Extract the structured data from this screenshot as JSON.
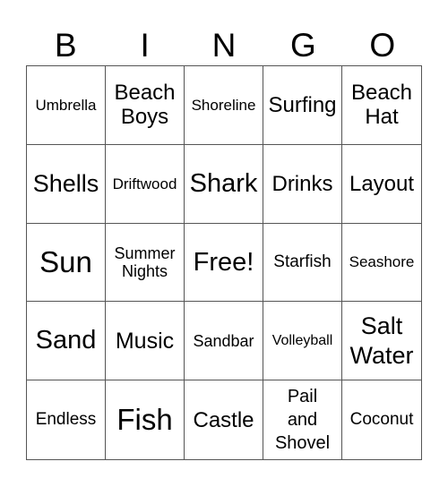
{
  "header": [
    "B",
    "I",
    "N",
    "G",
    "O"
  ],
  "cells": [
    "Umbrella",
    "Beach Boys",
    "Shoreline",
    "Surfing",
    "Beach Hat",
    "Shells",
    "Driftwood",
    "Shark",
    "Drinks",
    "Layout",
    "Sun",
    "Summer Nights",
    "Free!",
    "Starfish",
    "Seashore",
    "Sand",
    "Music",
    "Sandbar",
    "Volleyball",
    "Salt Water",
    "Endless",
    "Fish",
    "Castle",
    "Pail and Shovel",
    "Coconut"
  ]
}
